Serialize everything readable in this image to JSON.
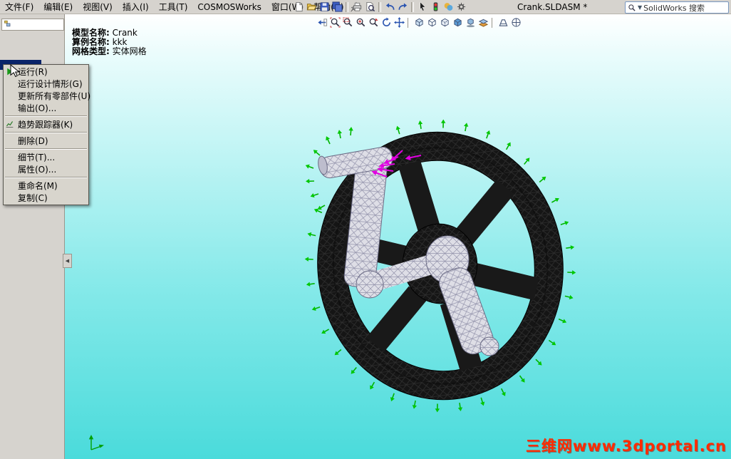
{
  "window": {
    "title": "Crank.SLDASM *"
  },
  "menubar": {
    "items": [
      "文件(F)",
      "编辑(E)",
      "视图(V)",
      "插入(I)",
      "工具(T)",
      "COSMOSWorks",
      "窗口(W)",
      "帮助(H)"
    ]
  },
  "toolbar_main": {
    "icons": [
      "new-document",
      "open",
      "save",
      "save-all",
      "print",
      "print-preview",
      "undo",
      "redo",
      "select",
      "rebuild",
      "edit-appearance",
      "options"
    ]
  },
  "toolbar_view": {
    "icons": [
      "previous-view",
      "zoom-to-fit",
      "zoom-to-area",
      "zoom-in-out",
      "zoom-to-selection",
      "rotate-view",
      "pan",
      "standard-views",
      "wireframe",
      "hidden-lines-visible",
      "shaded",
      "shadows",
      "section-view",
      "perspective",
      "view-orientation"
    ]
  },
  "search": {
    "label": "SolidWorks 搜索"
  },
  "context_menu": {
    "items": [
      "运行(R)",
      "运行设计情形(G)",
      "更新所有零部件(U)",
      "输出(O)...",
      "趋势跟踪器(K)",
      "删除(D)",
      "细节(T)...",
      "属性(O)...",
      "重命名(M)",
      "复制(C)"
    ]
  },
  "viewport": {
    "info": [
      {
        "label": "模型名称:",
        "value": "Crank"
      },
      {
        "label": "算例名称:",
        "value": "kkk"
      },
      {
        "label": "网格类型:",
        "value": "实体网格"
      }
    ]
  },
  "watermark": {
    "text": "三维网www.3dportal.cn"
  },
  "colors": {
    "chrome_gray": "#d6d3ce",
    "viewport_top": "#ffffff",
    "viewport_bottom": "#42d9d9",
    "restraint_green": "#00c800",
    "load_magenta": "#e000e0",
    "selection_blue": "#0a246a",
    "watermark_red": "#ff2b00",
    "mesh_dark": "#151515",
    "mesh_light": "#dedee6"
  }
}
